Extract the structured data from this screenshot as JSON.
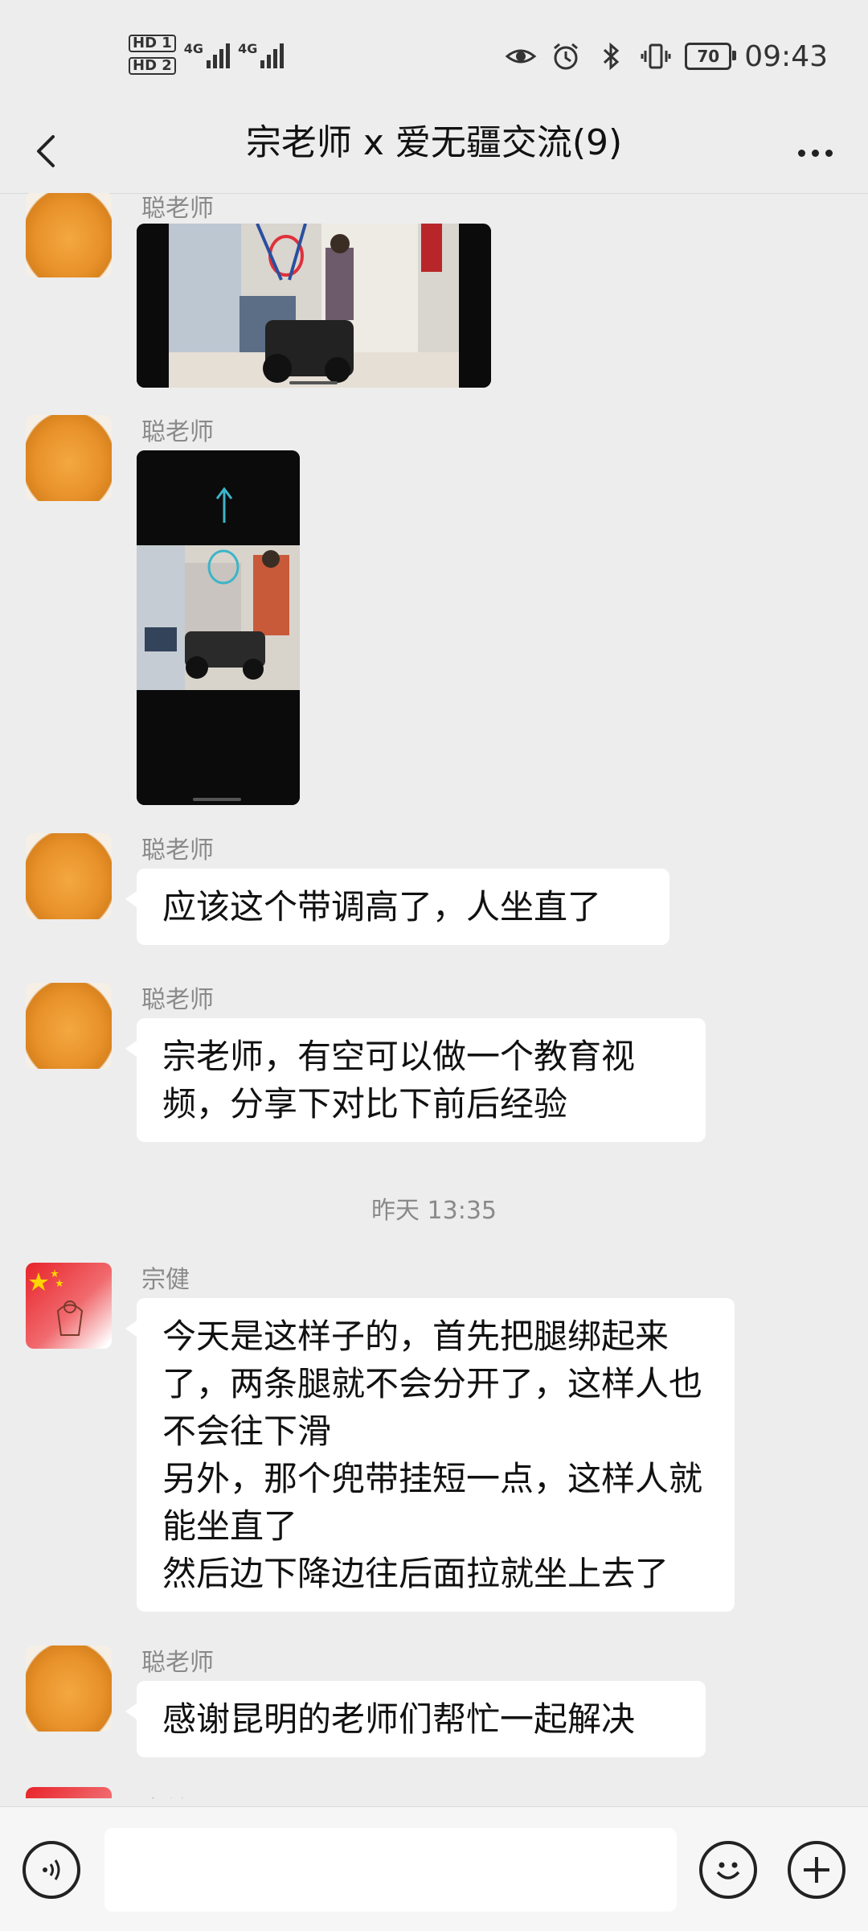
{
  "status_bar": {
    "hd1": "HD 1",
    "hd2": "HD 2",
    "net1": "4G",
    "net2": "4G",
    "battery": "70",
    "time": "09:43"
  },
  "header": {
    "title": "宗老师 x 爱无疆交流(9)"
  },
  "messages": [
    {
      "sender": "聪老师",
      "type": "image",
      "avatar": "pancake-icon"
    },
    {
      "sender": "聪老师",
      "type": "image",
      "avatar": "pancake-icon"
    },
    {
      "sender": "聪老师",
      "type": "text",
      "text": "应该这个带调高了，人坐直了"
    },
    {
      "sender": "聪老师",
      "type": "text",
      "text": "宗老师，有空可以做一个教育视频，分享下对比下前后经验"
    },
    {
      "sender": "宗健",
      "type": "text",
      "text": "今天是这样子的，首先把腿绑起来了，两条腿就不会分开了，这样人也不会往下滑\n另外，那个兜带挂短一点，这样人就能坐直了\n然后边下降边往后面拉就坐上去了"
    },
    {
      "sender": "聪老师",
      "type": "text",
      "text": "感谢昆明的老师们帮忙一起解决"
    },
    {
      "sender": "宗健",
      "type": "partial"
    }
  ],
  "timestamp": "昨天 13:35",
  "colors": {
    "background": "#ededed",
    "bubble": "#ffffff",
    "name": "#8a8a8a"
  }
}
